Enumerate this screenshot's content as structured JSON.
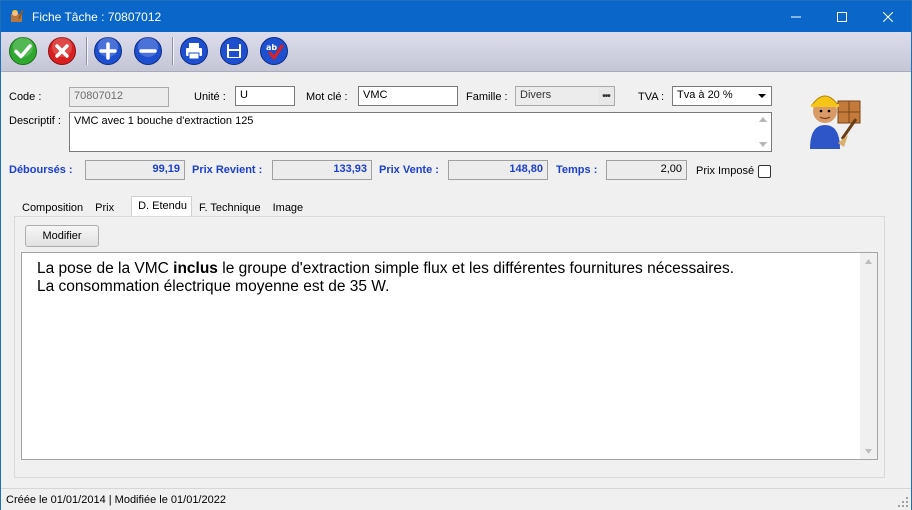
{
  "window": {
    "title": "Fiche Tâche : 70807012"
  },
  "toolbar": {
    "buttons": [
      {
        "name": "validate",
        "icon": "check-icon",
        "color": "#2ea82e"
      },
      {
        "name": "cancel",
        "icon": "cross-icon",
        "color": "#d92020"
      },
      {
        "name": "add",
        "icon": "plus-icon",
        "color": "#1d4fcf"
      },
      {
        "name": "remove",
        "icon": "minus-icon",
        "color": "#1d4fcf"
      },
      {
        "name": "print",
        "icon": "printer-icon",
        "color": "#1d4fcf"
      },
      {
        "name": "save",
        "icon": "floppy-disk-icon",
        "color": "#1d4fcf"
      },
      {
        "name": "spellcheck",
        "icon": "spellcheck-icon",
        "color": "#1d4fcf"
      }
    ]
  },
  "form": {
    "code_label": "Code :",
    "code_value": "70807012",
    "unite_label": "Unité :",
    "unite_value": "U",
    "motcle_label": "Mot clé :",
    "motcle_value": "VMC",
    "famille_label": "Famille :",
    "famille_value": "Divers",
    "famille_button": "•••",
    "tva_label": "TVA :",
    "tva_value": "Tva à 20 %",
    "descriptif_label": "Descriptif :",
    "descriptif_value": "VMC avec 1 bouche d'extraction 125"
  },
  "totals": {
    "debourses_label": "Déboursés :",
    "debourses_value": "99,19",
    "prix_revient_label": "Prix Revient :",
    "prix_revient_value": "133,93",
    "prix_vente_label": "Prix Vente :",
    "prix_vente_value": "148,80",
    "temps_label": "Temps :",
    "temps_value": "2,00",
    "prix_impose_label": "Prix Imposé",
    "prix_impose_checked": false
  },
  "tabs": [
    {
      "label": "Composition",
      "active": false
    },
    {
      "label": "Prix",
      "active": false
    },
    {
      "label": "D. Etendu",
      "active": true
    },
    {
      "label": "F. Technique",
      "active": false
    },
    {
      "label": "Image",
      "active": false
    }
  ],
  "detail": {
    "modifier_label": "Modifier",
    "line1_before": "La pose de la VMC ",
    "line1_bold": "inclus",
    "line1_after": " le groupe d'extraction simple flux et les différentes fournitures nécessaires.",
    "line2": "La consommation électrique moyenne est de 35 W."
  },
  "status": {
    "text": "Créée le 01/01/2014 | Modifiée le 01/01/2022"
  },
  "colors": {
    "titlebar": "#0a67c9",
    "label_blue": "#1b3fd0"
  }
}
